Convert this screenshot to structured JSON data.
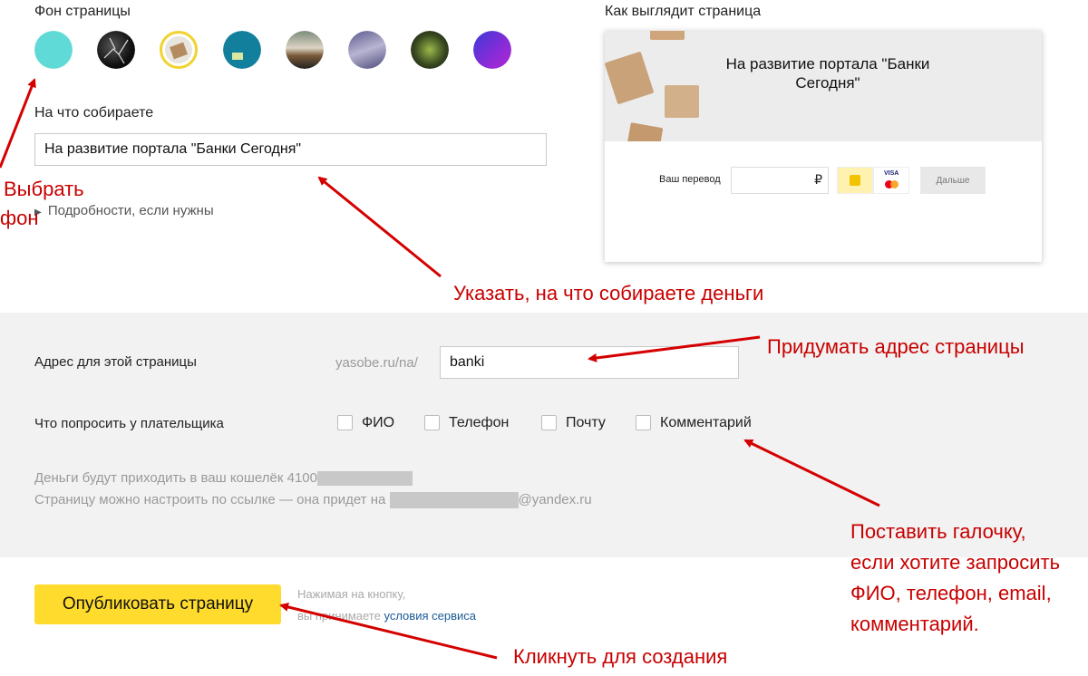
{
  "background_section": {
    "label": "Фон страницы",
    "swatches": [
      {
        "name": "turquoise"
      },
      {
        "name": "dark-crack"
      },
      {
        "name": "boxes",
        "selected": true
      },
      {
        "name": "teal"
      },
      {
        "name": "road"
      },
      {
        "name": "mountains"
      },
      {
        "name": "plant"
      },
      {
        "name": "purple-gradient"
      }
    ]
  },
  "purpose": {
    "label": "На что собираете",
    "value": "На развитие портала \"Банки Сегодня\"",
    "details_link": "Подробности, если нужны"
  },
  "preview": {
    "label": "Как выглядит страница",
    "title": "На развитие портала \"Банки Сегодня\"",
    "transfer_label": "Ваш перевод",
    "currency": "₽",
    "visa": "VISA",
    "next_button": "Дальше"
  },
  "address": {
    "label": "Адрес для этой страницы",
    "prefix": "yasobe.ru/na/",
    "value": "banki"
  },
  "ask_payer": {
    "label": "Что попросить у плательщика",
    "options": [
      "ФИО",
      "Телефон",
      "Почту",
      "Комментарий"
    ]
  },
  "info": {
    "wallet_text": "Деньги будут приходить в ваш кошелёк 4100",
    "email_text": "Страницу можно настроить по ссылке — она придет на",
    "email_domain": "@yandex.ru"
  },
  "publish": {
    "button": "Опубликовать страницу",
    "note1": "Нажимая на кнопку,",
    "note2": "вы принимаете",
    "terms_link": "условия сервиса"
  },
  "annotations": {
    "choose_bg_1": "Выбрать",
    "choose_bg_2": "фон",
    "specify": "Указать, на что собираете деньги",
    "address": "Придумать адрес страницы",
    "checkbox_1": "Поставить галочку,",
    "checkbox_2": "если хотите запросить",
    "checkbox_3": "ФИО, телефон, email,",
    "checkbox_4": "комментарий.",
    "click": "Кликнуть для создания"
  },
  "colors": {
    "accent_yellow": "#ffdb2e",
    "annotation_red": "#c80000",
    "link_blue": "#1a5a96",
    "panel_gray": "#f2f2f2"
  }
}
